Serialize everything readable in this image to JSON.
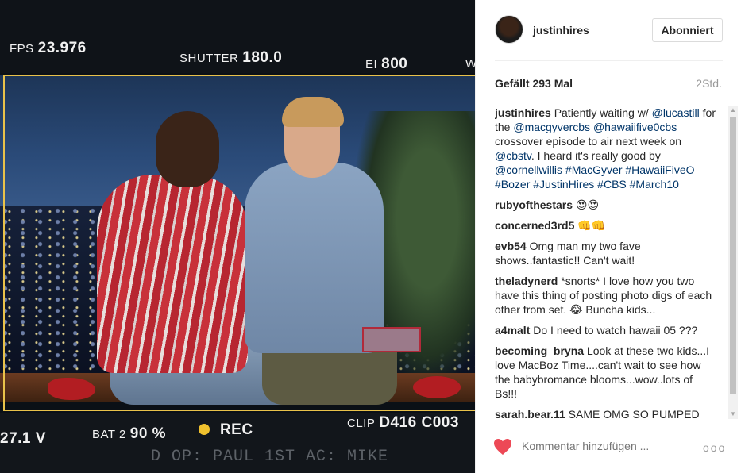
{
  "photo": {
    "hud_top": {
      "fps_label": "FPS",
      "fps_value": "23.976",
      "shutter_label": "SHUTTER",
      "shutter_value": "180.0",
      "ei_label": "EI",
      "ei_value": "800",
      "wb_fragment": "W"
    },
    "hud_bottom": {
      "left_value": "27.1 V",
      "bat_label": "BAT 2",
      "bat_value": "90 %",
      "rec_label": "REC",
      "clip_label": "CLIP",
      "clip_value": "D416 C003"
    },
    "crew_text": "D OP: PAUL  1ST AC: MIKE",
    "colors": {
      "frame": "#e9c24a",
      "rec_dot": "#f0c12e"
    }
  },
  "post": {
    "username": "justinhires",
    "follow_label": "Abonniert",
    "likes": "Gefällt 293 Mal",
    "time": "2Std.",
    "caption": {
      "user": "justinhires",
      "parts": [
        {
          "t": "Patiently waiting w/ "
        },
        {
          "t": "@lucastill",
          "link": true
        },
        {
          "t": " for the "
        },
        {
          "t": "@macgyvercbs",
          "link": true
        },
        {
          "t": " "
        },
        {
          "t": "@hawaiifive0cbs",
          "link": true
        },
        {
          "t": " crossover episode to air next week on "
        },
        {
          "t": "@cbstv",
          "link": true
        },
        {
          "t": ". I heard it's really good  by "
        },
        {
          "t": "@cornellwillis",
          "link": true
        },
        {
          "t": " "
        },
        {
          "t": "#MacGyver",
          "link": true
        },
        {
          "t": " "
        },
        {
          "t": "#HawaiiFiveO",
          "link": true
        },
        {
          "t": " "
        },
        {
          "t": "#Bozer",
          "link": true
        },
        {
          "t": " "
        },
        {
          "t": "#JustinHires",
          "link": true
        },
        {
          "t": " "
        },
        {
          "t": "#CBS",
          "link": true
        },
        {
          "t": " "
        },
        {
          "t": "#March10",
          "link": true
        }
      ]
    },
    "comments": [
      {
        "user": "rubyofthestars",
        "text": "😍😍"
      },
      {
        "user": "concerned3rd5",
        "text": "👊👊"
      },
      {
        "user": "evb54",
        "text": "Omg man my two fave shows..fantastic!! Can't wait!"
      },
      {
        "user": "theladynerd",
        "text": "*snorts* I love how you two have this thing of posting photo digs of each other from set. 😂 Buncha kids..."
      },
      {
        "user": "a4malt",
        "text": "Do I need to watch hawaii 05 ???"
      },
      {
        "user": "becoming_bryna",
        "text": "Look at these two kids...I love MacBoz Time....can't wait to see how the babybromance blooms...wow..lots of Bs!!!"
      },
      {
        "user": "sarah.bear.11",
        "text": "SAME OMG SO PUMPED"
      }
    ],
    "comment_placeholder": "Kommentar hinzufügen ...",
    "more_label": "ooo",
    "icons": {
      "heart": "heart-icon",
      "more": "more-options-icon"
    },
    "colors": {
      "heart": "#ed4956",
      "link": "#003569"
    }
  }
}
